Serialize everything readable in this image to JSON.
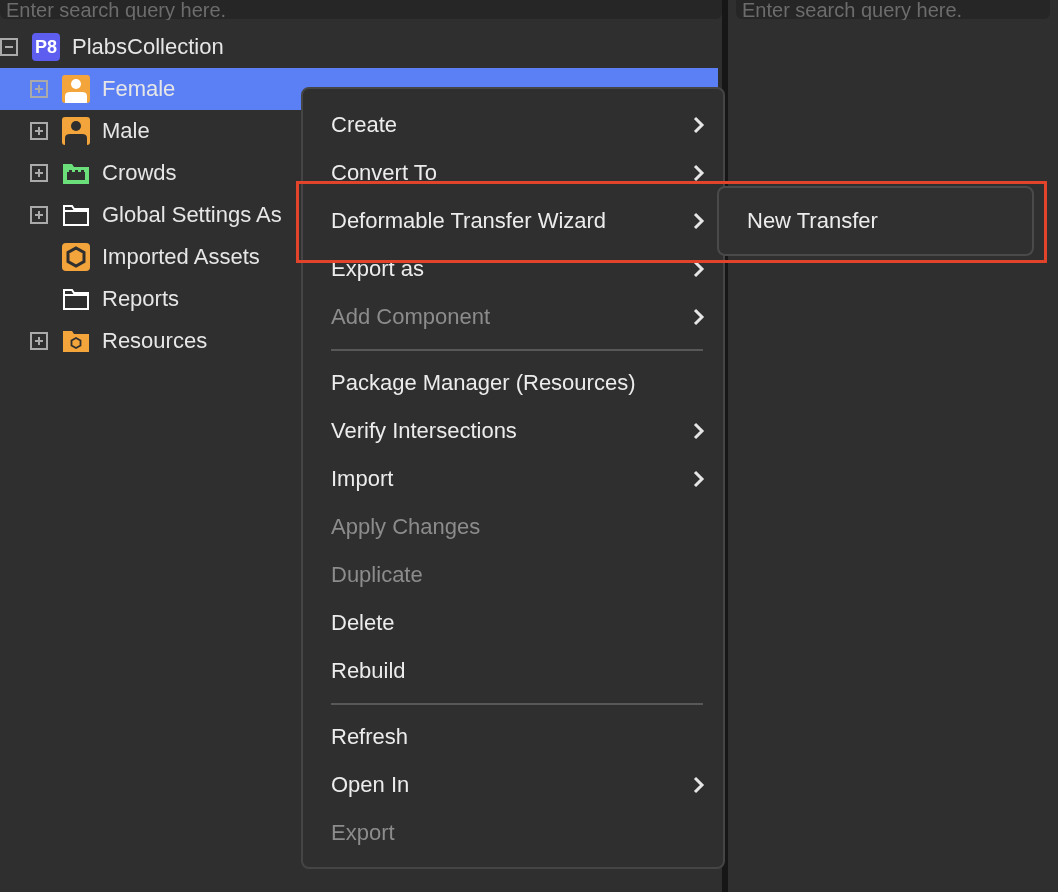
{
  "search_fields": [
    {
      "placeholder": "Enter search query here."
    },
    {
      "placeholder": "Enter search query here."
    }
  ],
  "tree": {
    "label": "PlabsCollection",
    "badge": "P8",
    "expanded": true,
    "selected": false,
    "children": [
      {
        "label": "Female",
        "expanded": false,
        "selected": true
      },
      {
        "label": "Male",
        "expanded": false,
        "selected": false
      },
      {
        "label": "Crowds",
        "expanded": false,
        "selected": false
      },
      {
        "label": "Global Settings As",
        "expanded": false,
        "selected": false
      },
      {
        "label": "Imported Assets",
        "selected": false
      },
      {
        "label": "Reports",
        "selected": false
      },
      {
        "label": "Resources",
        "expanded": false,
        "selected": false
      }
    ]
  },
  "context_menu": {
    "items": [
      {
        "kind": "item",
        "label": "Create",
        "disabled": false,
        "submenu": true
      },
      {
        "kind": "item",
        "label": "Convert To",
        "disabled": false,
        "submenu": true
      },
      {
        "kind": "item",
        "label": "Deformable Transfer Wizard",
        "disabled": false,
        "submenu": true,
        "open": true,
        "highlighted": true,
        "children": [
          {
            "label": "New Transfer"
          }
        ]
      },
      {
        "kind": "item",
        "label": "Export as",
        "disabled": false,
        "submenu": true
      },
      {
        "kind": "item",
        "label": "Add Component",
        "disabled": true,
        "submenu": true
      },
      {
        "kind": "separator"
      },
      {
        "kind": "item",
        "label": "Package Manager (Resources)",
        "disabled": false,
        "submenu": false
      },
      {
        "kind": "item",
        "label": "Verify Intersections",
        "disabled": false,
        "submenu": true
      },
      {
        "kind": "item",
        "label": "Import",
        "disabled": false,
        "submenu": true
      },
      {
        "kind": "item",
        "label": "Apply Changes",
        "disabled": true,
        "submenu": false
      },
      {
        "kind": "item",
        "label": "Duplicate",
        "disabled": true,
        "submenu": false
      },
      {
        "kind": "item",
        "label": "Delete",
        "disabled": false,
        "submenu": false
      },
      {
        "kind": "item",
        "label": "Rebuild",
        "disabled": false,
        "submenu": false
      },
      {
        "kind": "separator"
      },
      {
        "kind": "item",
        "label": "Refresh",
        "disabled": false,
        "submenu": false
      },
      {
        "kind": "item",
        "label": "Open In",
        "disabled": false,
        "submenu": true
      },
      {
        "kind": "item",
        "label": "Export",
        "disabled": true,
        "submenu": false
      }
    ]
  }
}
